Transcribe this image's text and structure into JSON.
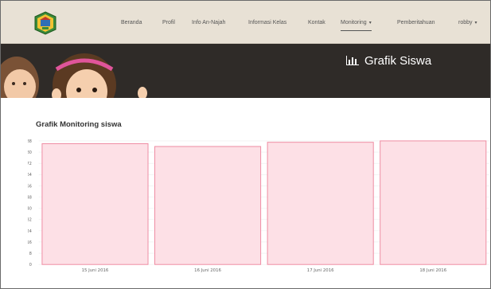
{
  "nav": {
    "items": [
      {
        "label": "Beranda"
      },
      {
        "label": "Profil"
      },
      {
        "label": "Info An-Najah"
      },
      {
        "label": "Informasi Kelas"
      },
      {
        "label": "Kontak"
      },
      {
        "label": "Monitoring",
        "caret": "▾",
        "active": true
      },
      {
        "label": "Pemberitahuan"
      },
      {
        "label": "robby",
        "caret": "▾"
      }
    ]
  },
  "banner": {
    "title": "Grafik Siswa",
    "icon": "bar-chart-icon"
  },
  "section": {
    "title": "Grafik Monitoring siswa"
  },
  "colors": {
    "bar_fill": "#fde0e6",
    "bar_stroke": "#ee8aa1",
    "banner_bg": "#2f2b28",
    "nav_bg": "#e8e1d5"
  },
  "chart_data": {
    "type": "bar",
    "categories": [
      "15 Juni 2016",
      "16 Juni 2016",
      "17 Juni 2016",
      "18 Juni 2016"
    ],
    "values": [
      86,
      84,
      87,
      88
    ],
    "ylim": [
      0,
      88
    ],
    "yticks": [
      0,
      8,
      16,
      24,
      32,
      40,
      48,
      56,
      64,
      72,
      80,
      88
    ],
    "grid": true,
    "title": "",
    "xlabel": "",
    "ylabel": ""
  }
}
